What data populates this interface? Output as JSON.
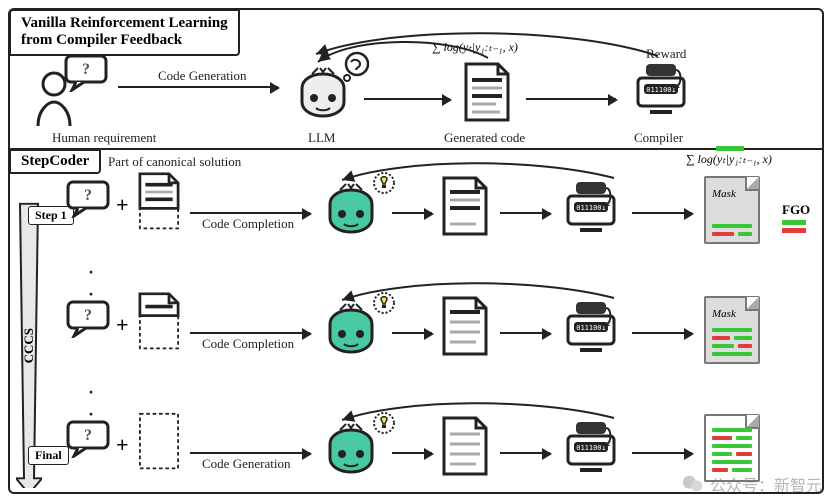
{
  "vanilla": {
    "title_line1": "Vanilla Reinforcement Learning",
    "title_line2": "from Compiler Feedback",
    "human_label": "Human requirement",
    "code_gen_label": "Code Generation",
    "llm_label": "LLM",
    "generated_code_label": "Generated code",
    "reward_label": "Reward",
    "compiler_label": "Compiler",
    "log_formula": "∑ log(yₜ|y₁:ₜ₋₁, x)"
  },
  "stepcoder": {
    "title": "StepCoder",
    "part_label": "Part of canonical solution",
    "cccs": "CCCS",
    "fgo": "FGO",
    "log_formula": "∑ log(yₜ|y₁:ₜ₋₁, x)",
    "mask_label": "Mask",
    "rows": [
      {
        "step": "Step 1",
        "action": "Code Completion"
      },
      {
        "step": "",
        "action": "Code Completion"
      },
      {
        "step": "Final",
        "action": "Code Generation"
      }
    ]
  },
  "watermark": "公众号：新智元"
}
